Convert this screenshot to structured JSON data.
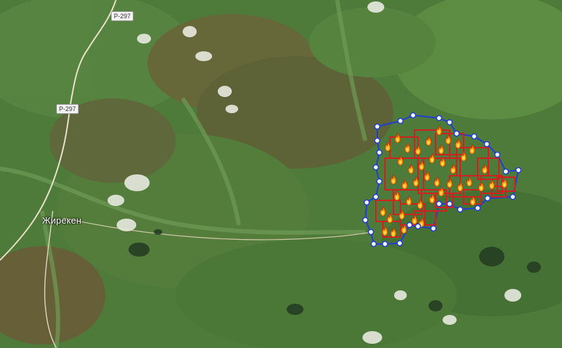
{
  "map": {
    "road_shield": "Р-297",
    "town": "Жирекен",
    "colors": {
      "fire_perimeter": "#d21f1f",
      "hotspot_boundary": "#1f3fd6",
      "vertex_fill": "#ffffff",
      "flame": "#ff7a00"
    },
    "fire_icon": "flame-icon"
  }
}
